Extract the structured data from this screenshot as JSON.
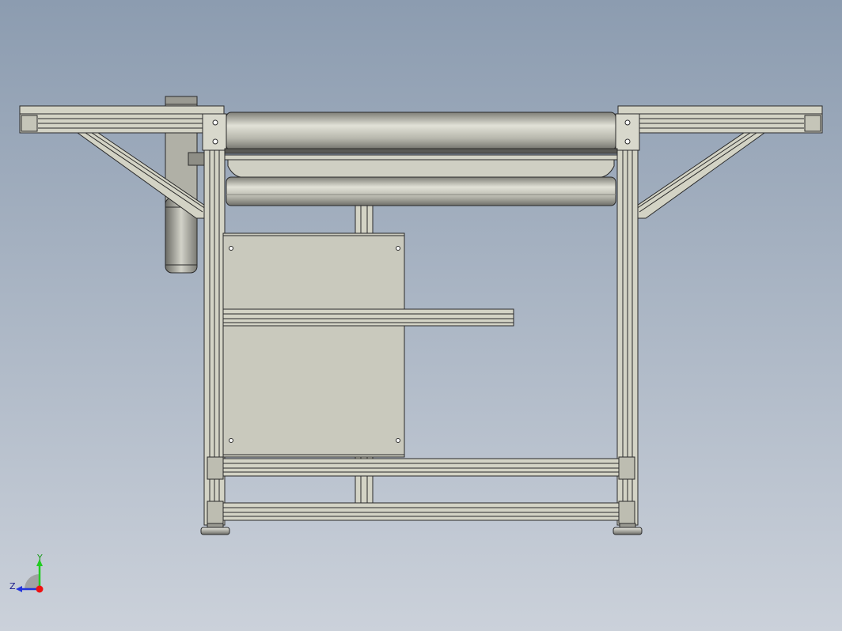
{
  "viewport": {
    "background_top": "#8c9cb0",
    "background_bottom": "#cbd1da"
  },
  "model": {
    "profile_color": "#d3d3c5",
    "profile_edge": "#2a2a2a",
    "roller_light": "#e0e0d4",
    "roller_dark": "#8a8a82",
    "plate_color": "#c8c8bc",
    "motor_color": "#a9a9a1"
  },
  "triad": {
    "y_label": "Y",
    "z_label": "Z",
    "y_color": "#22cc22",
    "z_color": "#2233dd",
    "x_color": "#ee1111"
  }
}
